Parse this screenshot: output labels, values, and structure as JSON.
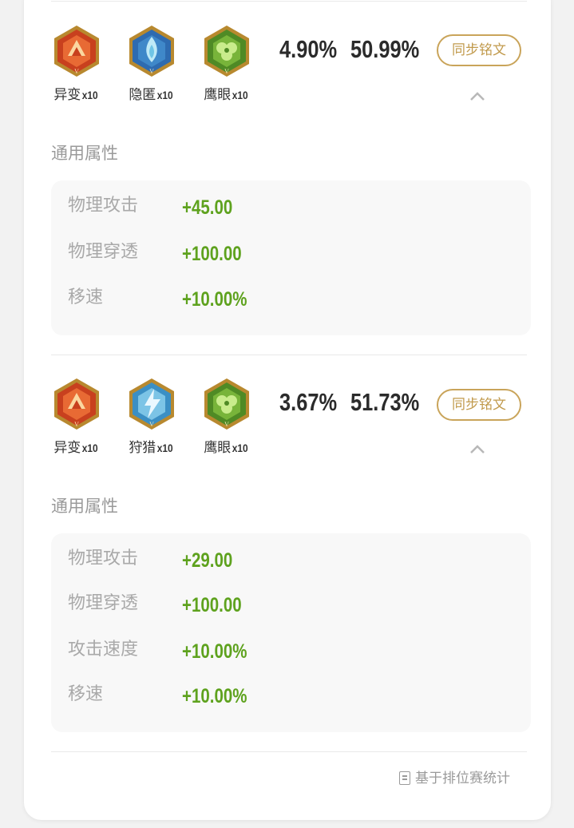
{
  "sets": [
    {
      "runes": [
        {
          "name": "异变",
          "count": "x10",
          "icon": "mutation-rune-icon",
          "color": "#c8401e"
        },
        {
          "name": "隐匿",
          "count": "x10",
          "icon": "stealth-rune-icon",
          "color": "#2e6bb0"
        },
        {
          "name": "鹰眼",
          "count": "x10",
          "icon": "hawkeye-rune-icon",
          "color": "#5a8f2a"
        }
      ],
      "pick_rate": "4.90%",
      "win_rate": "50.99%",
      "sync_label": "同步铭文",
      "section_title": "通用属性",
      "attributes": [
        {
          "name": "物理攻击",
          "value": "+45.00"
        },
        {
          "name": "物理穿透",
          "value": "+100.00"
        },
        {
          "name": "移速",
          "value": "+10.00%"
        }
      ]
    },
    {
      "runes": [
        {
          "name": "异变",
          "count": "x10",
          "icon": "mutation-rune-icon",
          "color": "#c8401e"
        },
        {
          "name": "狩猎",
          "count": "x10",
          "icon": "hunt-rune-icon",
          "color": "#3b8fc4"
        },
        {
          "name": "鹰眼",
          "count": "x10",
          "icon": "hawkeye-rune-icon",
          "color": "#5a8f2a"
        }
      ],
      "pick_rate": "3.67%",
      "win_rate": "51.73%",
      "sync_label": "同步铭文",
      "section_title": "通用属性",
      "attributes": [
        {
          "name": "物理攻击",
          "value": "+29.00"
        },
        {
          "name": "物理穿透",
          "value": "+100.00"
        },
        {
          "name": "攻击速度",
          "value": "+10.00%"
        },
        {
          "name": "移速",
          "value": "+10.00%"
        }
      ]
    }
  ],
  "footer": {
    "text": "基于排位赛统计",
    "icon": "document-icon"
  },
  "colors": {
    "accent": "#c9a45a",
    "positive": "#5ea21e",
    "muted": "#a9a9a9"
  }
}
